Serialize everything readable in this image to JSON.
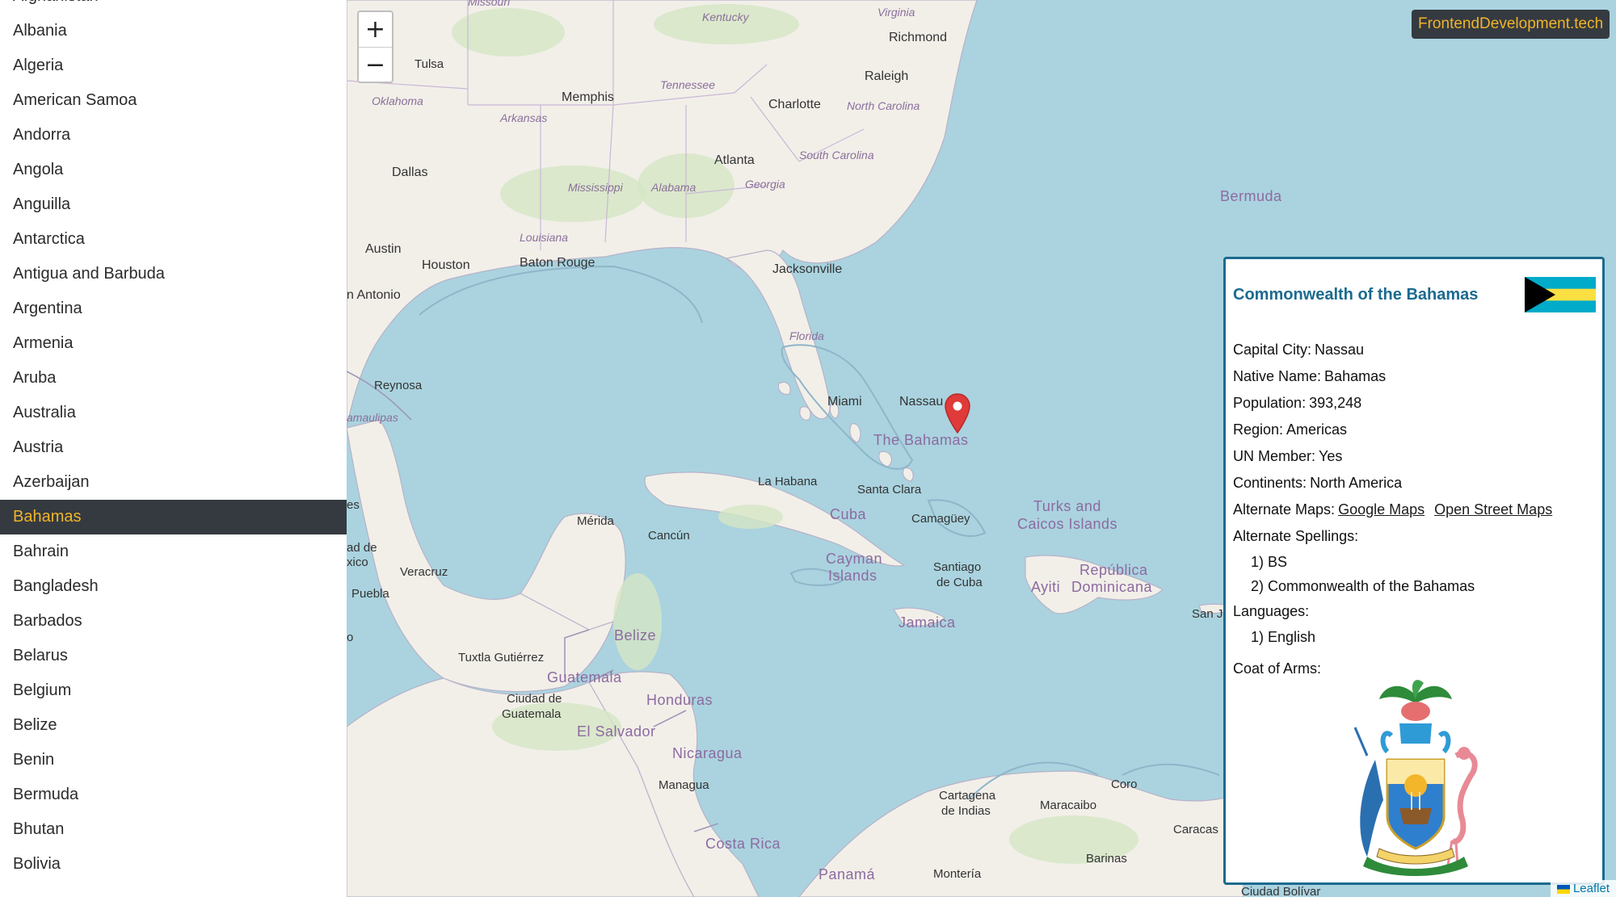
{
  "sidebar": {
    "countries": [
      "Afghanistan",
      "Albania",
      "Algeria",
      "American Samoa",
      "Andorra",
      "Angola",
      "Anguilla",
      "Antarctica",
      "Antigua and Barbuda",
      "Argentina",
      "Armenia",
      "Aruba",
      "Australia",
      "Austria",
      "Azerbaijan",
      "Bahamas",
      "Bahrain",
      "Bangladesh",
      "Barbados",
      "Belarus",
      "Belgium",
      "Belize",
      "Benin",
      "Bermuda",
      "Bhutan",
      "Bolivia"
    ],
    "selected": "Bahamas"
  },
  "map": {
    "zoom_in": "+",
    "zoom_out": "−",
    "labels": {
      "missouri": "Missouri",
      "kentucky": "Kentucky",
      "virginia": "Virginia",
      "richmond": "Richmond",
      "tulsa": "Tulsa",
      "oklahoma": "Oklahoma",
      "memphis": "Memphis",
      "tennessee": "Tennessee",
      "raleigh": "Raleigh",
      "charlotte": "Charlotte",
      "north_carolina": "North Carolina",
      "arkansas": "Arkansas",
      "atlanta": "Atlanta",
      "south_carolina": "South Carolina",
      "dallas": "Dallas",
      "mississippi": "Mississippi",
      "alabama": "Alabama",
      "georgia": "Georgia",
      "bermuda": "Bermuda",
      "louisiana": "Louisiana",
      "austin": "Austin",
      "houston": "Houston",
      "baton_rouge": "Baton Rouge",
      "jacksonville": "Jacksonville",
      "san_antonio": "n Antonio",
      "florida": "Florida",
      "reynosa": "Reynosa",
      "tamaulipas": "amaulipas",
      "miami": "Miami",
      "nassau": "Nassau",
      "the_bahamas": "The Bahamas",
      "la_habana": "La Habana",
      "santa_clara": "Santa Clara",
      "cuba": "Cuba",
      "camaguey": "Camagüey",
      "turks_caicos": "Turks and",
      "turks_caicos2": "Caicos Islands",
      "merida": "Mérida",
      "cancun": "Cancún",
      "es": "es",
      "ad_de": "ad de",
      "xico": "xico",
      "veracruz": "Veracruz",
      "puebla": "Puebla",
      "cayman": "Cayman",
      "cayman2": "Islands",
      "santiago": "Santiago",
      "santiago2": "de Cuba",
      "republica": "República",
      "ayiti": "Ayiti",
      "dominicana": "Dominicana",
      "san_juan": "San Ju",
      "jamaica": "Jamaica",
      "belize": "Belize",
      "o": "o",
      "tuxtla": "Tuxtla Gutiérrez",
      "guatemala": "Guatemala",
      "ciudad_guatemala": "Ciudad de",
      "ciudad_guatemala2": "Guatemala",
      "honduras": "Honduras",
      "el_salvador": "El Salvador",
      "nicaragua": "Nicaragua",
      "managua": "Managua",
      "cartagena": "Cartagena",
      "cartagena2": "de Indias",
      "maracaibo": "Maracaibo",
      "coro": "Coro",
      "caracas": "Caracas",
      "barinas": "Barinas",
      "costa_rica": "Costa Rica",
      "panama": "Panamá",
      "monteria": "Montería",
      "ciudad_bolivar": "Ciudad Bolívar"
    },
    "attribution": "Leaflet"
  },
  "brand": "FrontendDevelopment.tech",
  "info": {
    "title": "Commonwealth of the Bahamas",
    "capital_label": "Capital City:",
    "capital": "Nassau",
    "native_label": "Native Name:",
    "native": "Bahamas",
    "population_label": "Population:",
    "population": "393,248",
    "region_label": "Region:",
    "region": "Americas",
    "un_label": "UN Member:",
    "un": "Yes",
    "continents_label": "Continents:",
    "continents": "North America",
    "maps_label": "Alternate Maps:",
    "google_maps": "Google Maps",
    "osm": "Open Street Maps",
    "spellings_label": "Alternate Spellings:",
    "spellings": [
      "1) BS",
      "2) Commonwealth of the Bahamas"
    ],
    "languages_label": "Languages:",
    "languages": [
      "1) English"
    ],
    "coat_label": "Coat of Arms:"
  },
  "colors": {
    "accent": "#1b6a8f",
    "brand_text": "#f0b429",
    "dark": "#343a40",
    "marker": "#e03a3a",
    "water": "#aad3df",
    "land": "#f2efe9"
  }
}
